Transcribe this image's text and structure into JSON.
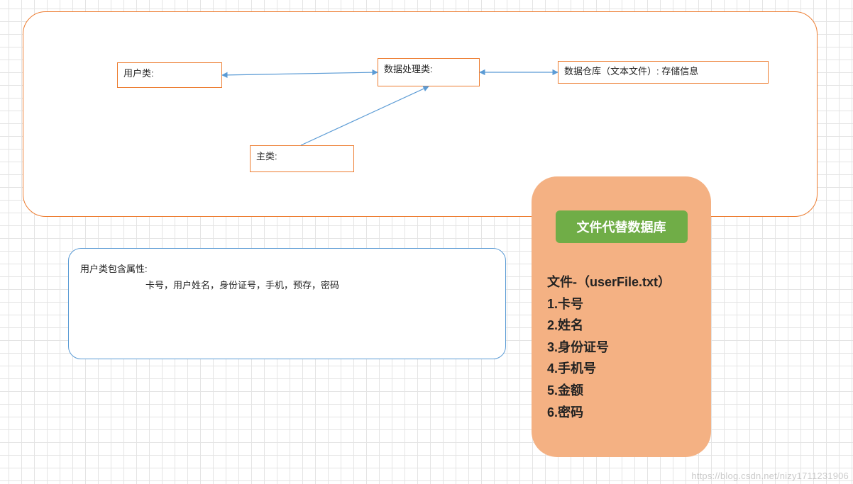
{
  "diagram": {
    "user_box": "用户类:",
    "process_box": "数据处理类:",
    "store_box": "数据仓库（文本文件）: 存储信息",
    "main_box": "主类:"
  },
  "attributes": {
    "title": "用户类包含属性:",
    "list": "卡号，用户姓名，身份证号，手机，预存，密码"
  },
  "file_card": {
    "header": "文件代替数据库",
    "file_title": "文件-（userFile.txt）",
    "items": [
      "1.卡号",
      "2.姓名",
      "3.身份证号",
      "4.手机号",
      "5.金额",
      "6.密码"
    ]
  },
  "watermark": "https://blog.csdn.net/nizy1711231906"
}
